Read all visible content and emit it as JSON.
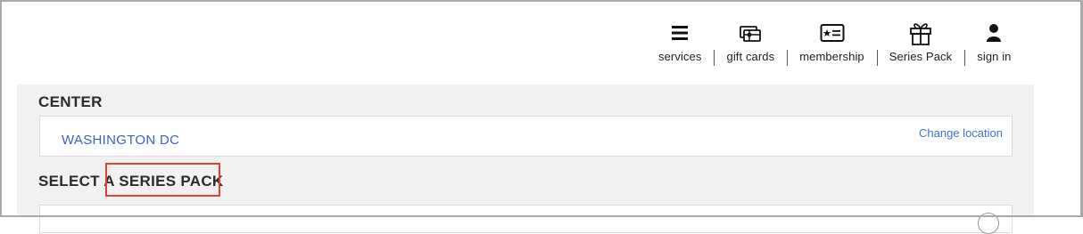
{
  "nav": {
    "items": [
      {
        "label": "services",
        "icon": "menu-icon"
      },
      {
        "label": "gift cards",
        "icon": "gift-card-icon"
      },
      {
        "label": "membership",
        "icon": "membership-card-icon"
      },
      {
        "label": "Series Pack",
        "icon": "gift-box-icon"
      },
      {
        "label": "sign in",
        "icon": "user-icon"
      }
    ]
  },
  "center": {
    "title": "CENTER",
    "value": "WASHINGTON DC",
    "change_link": "Change location"
  },
  "series": {
    "title": "SELECT A SERIES PACK"
  },
  "colors": {
    "link": "#3d61c4",
    "panel_bg": "#f1f1f1",
    "highlight": "#e0403a"
  }
}
